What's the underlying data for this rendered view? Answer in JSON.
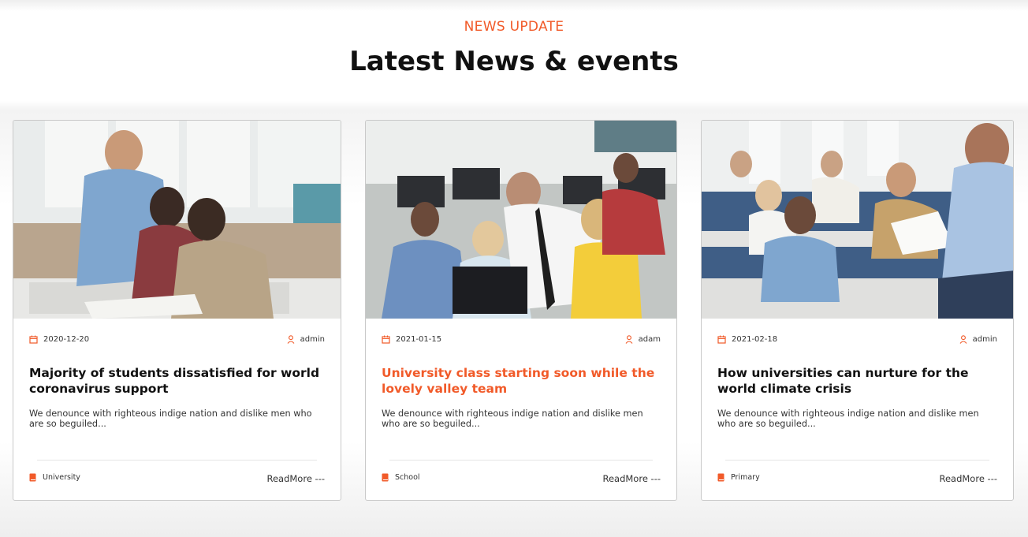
{
  "section": {
    "subtitle": "NEWS UPDATE",
    "title": "Latest News & events"
  },
  "colors": {
    "accent": "#f15a29",
    "text": "#111111"
  },
  "cards": [
    {
      "date": "2020-12-20",
      "author": "admin",
      "title": "Majority of students dissatisfied for world coronavirus support",
      "excerpt": "We denounce with righteous indige nation and dislike men who are so beguiled...",
      "category": "University",
      "readmore": "ReadMore ---",
      "image": "teacher-helping-students-photo",
      "highlighted": false
    },
    {
      "date": "2021-01-15",
      "author": "adam",
      "title": "University class starting soon while the lovely valley team",
      "excerpt": "We denounce with righteous indige nation and dislike men who are so beguiled...",
      "category": "School",
      "readmore": "ReadMore ---",
      "image": "computer-lab-class-photo",
      "highlighted": true
    },
    {
      "date": "2021-02-18",
      "author": "admin",
      "title": "How universities can nurture for the world climate crisis",
      "excerpt": "We denounce with righteous indige nation and dislike men who are so beguiled...",
      "category": "Primary",
      "readmore": "ReadMore ---",
      "image": "lecture-hall-students-photo",
      "highlighted": false
    }
  ],
  "icons": {
    "date": "calendar-icon",
    "author": "user-icon",
    "category": "book-icon"
  }
}
